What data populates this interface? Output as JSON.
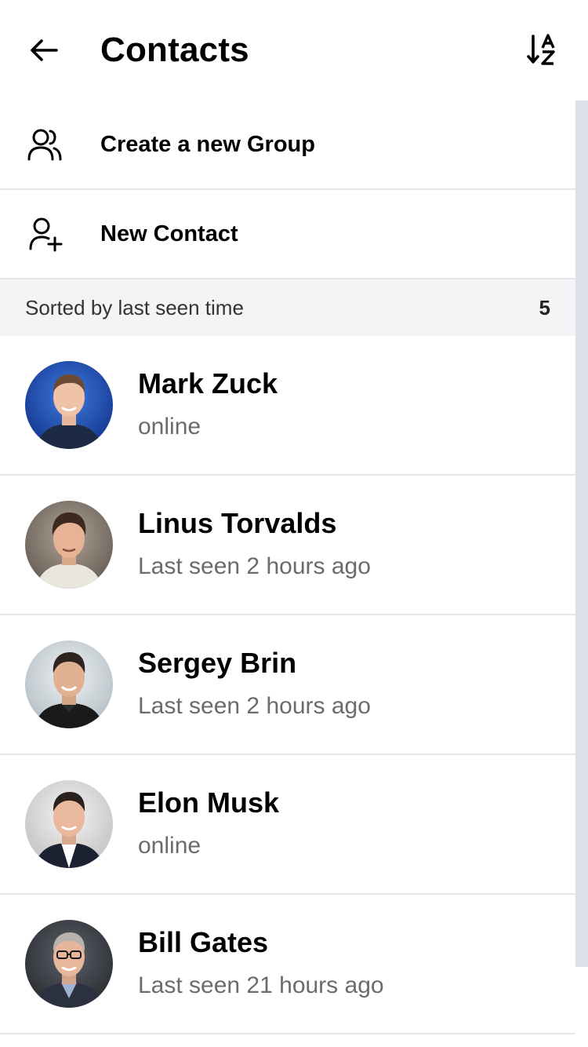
{
  "header": {
    "title": "Contacts",
    "back_icon": "arrow-left-icon",
    "sort_icon": "sort-alpha-az-icon"
  },
  "actions": [
    {
      "label": "Create a new Group",
      "icon": "group-icon"
    },
    {
      "label": "New Contact",
      "icon": "add-person-icon"
    }
  ],
  "section": {
    "label": "Sorted by last seen time",
    "count": "5"
  },
  "contacts": [
    {
      "name": "Mark Zuck",
      "status": "online",
      "avatar_bg": "#1f4fb3"
    },
    {
      "name": "Linus Torvalds",
      "status": "Last seen 2 hours ago",
      "avatar_bg": "#8a7d72"
    },
    {
      "name": "Sergey Brin",
      "status": "Last seen 2 hours ago",
      "avatar_bg": "#c9d2d8"
    },
    {
      "name": "Elon Musk",
      "status": "online",
      "avatar_bg": "#d6d6d6"
    },
    {
      "name": "Bill Gates",
      "status": "Last seen 21 hours ago",
      "avatar_bg": "#3c3f46"
    }
  ],
  "colors": {
    "divider": "#e3e5e8",
    "section_bg": "#f3f4f6",
    "status_text": "#6b6b6b",
    "scrollbar": "#dde1e7"
  }
}
